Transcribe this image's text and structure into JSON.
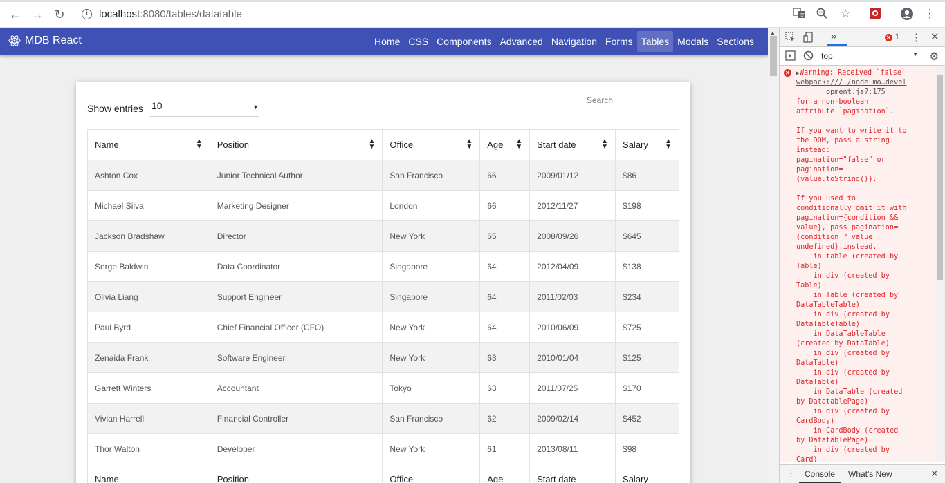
{
  "browser": {
    "url_host": "localhost",
    "url_rest": ":8080/tables/datatable"
  },
  "navbar": {
    "brand": "MDB React",
    "links": [
      "Home",
      "CSS",
      "Components",
      "Advanced",
      "Navigation",
      "Forms",
      "Tables",
      "Modals",
      "Sections"
    ],
    "active": "Tables",
    "color": "#3f51b5"
  },
  "datatable": {
    "show_entries_label": "Show entries",
    "entries_value": "10",
    "search_placeholder": "Search",
    "columns": [
      "Name",
      "Position",
      "Office",
      "Age",
      "Start date",
      "Salary"
    ],
    "rows": [
      [
        "Ashton Cox",
        "Junior Technical Author",
        "San Francisco",
        "66",
        "2009/01/12",
        "$86"
      ],
      [
        "Michael Silva",
        "Marketing Designer",
        "London",
        "66",
        "2012/11/27",
        "$198"
      ],
      [
        "Jackson Bradshaw",
        "Director",
        "New York",
        "65",
        "2008/09/26",
        "$645"
      ],
      [
        "Serge Baldwin",
        "Data Coordinator",
        "Singapore",
        "64",
        "2012/04/09",
        "$138"
      ],
      [
        "Olivia Liang",
        "Support Engineer",
        "Singapore",
        "64",
        "2011/02/03",
        "$234"
      ],
      [
        "Paul Byrd",
        "Chief Financial Officer (CFO)",
        "New York",
        "64",
        "2010/06/09",
        "$725"
      ],
      [
        "Zenaida Frank",
        "Software Engineer",
        "New York",
        "63",
        "2010/01/04",
        "$125"
      ],
      [
        "Garrett Winters",
        "Accountant",
        "Tokyo",
        "63",
        "2011/07/25",
        "$170"
      ],
      [
        "Vivian Harrell",
        "Financial Controller",
        "San Francisco",
        "62",
        "2009/02/14",
        "$452"
      ],
      [
        "Thor Walton",
        "Developer",
        "New York",
        "61",
        "2013/08/11",
        "$98"
      ]
    ],
    "footer_columns": [
      "Name",
      "Position",
      "Office",
      "Age",
      "Start date",
      "Salary"
    ]
  },
  "devtools": {
    "more_tabs": "»",
    "error_count": "1",
    "context": "top",
    "console_message_head": "Warning: Received `false`",
    "console_link": "webpack:///./node_mo…devel\n       opment.js?:175",
    "console_message_body": "for a non-boolean\nattribute `pagination`.\n\nIf you want to write it to\nthe DOM, pass a string\ninstead:\npagination=\"false\" or\npagination=\n{value.toString()}.\n\nIf you used to\nconditionally omit it with\npagination={condition &&\nvalue}, pass pagination=\n{condition ? value :\nundefined} instead.\n    in table (created by\nTable)\n    in div (created by\nTable)\n    in Table (created by\nDataTableTable)\n    in div (created by\nDataTableTable)\n    in DataTableTable\n(created by DataTable)\n    in div (created by\nDataTable)\n    in div (created by\nDataTable)\n    in DataTable (created\nby DatatablePage)\n    in div (created by\nCardBody)\n    in CardBody (created\nby DatatablePage)\n    in div (created by\nCard)",
    "drawer_tabs": [
      "Console",
      "What's New"
    ]
  }
}
